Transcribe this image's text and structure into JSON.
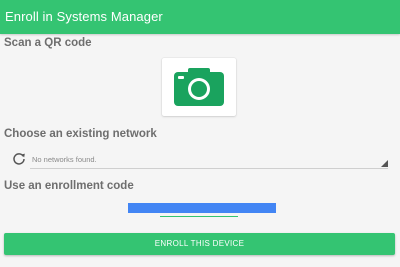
{
  "app": {
    "title": "Enroll in Systems Manager"
  },
  "qr_section": {
    "title": "Scan a QR code",
    "icon": "camera-icon"
  },
  "network_section": {
    "title": "Choose an existing network",
    "refresh_icon": "refresh-icon",
    "selected_value": "No networks found."
  },
  "code_section": {
    "title": "Use an enrollment code",
    "value": ""
  },
  "enroll_button": {
    "label": "ENROLL THIS DEVICE"
  },
  "colors": {
    "accent": "#34c472",
    "input_highlight": "#4285f4",
    "section_text": "#6e6e6e",
    "background": "#f5f5f5"
  }
}
